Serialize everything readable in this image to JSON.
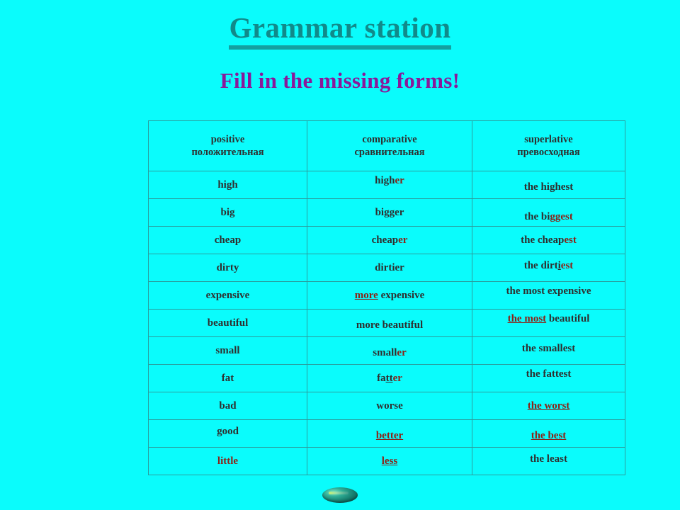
{
  "title": "Grammar station",
  "subtitle": "Fill in the missing forms!",
  "colors": {
    "background": "#0afcfc",
    "title": "#118a8a",
    "title_underline": "#13a0a0",
    "subtitle": "#8a189a",
    "table_border": "#2b9c9c",
    "text_dark": "#2f2f2f",
    "text_highlight": "#8a2318"
  },
  "table": {
    "headers": [
      {
        "en": "positive",
        "ru": "положительная"
      },
      {
        "en": "comparative",
        "ru": "сравнительная"
      },
      {
        "en": "superlative",
        "ru": "превосходная"
      }
    ],
    "rows": [
      {
        "positive": {
          "parts": [
            {
              "text": "high",
              "style": "dark"
            }
          ]
        },
        "comparative": {
          "parts": [
            {
              "text": "high",
              "style": "dark"
            },
            {
              "text": "er",
              "style": "hl"
            }
          ]
        },
        "superlative": {
          "parts": [
            {
              "text": "the highest",
              "style": "dark"
            }
          ]
        }
      },
      {
        "positive": {
          "parts": [
            {
              "text": "big",
              "style": "dark"
            }
          ]
        },
        "comparative": {
          "parts": [
            {
              "text": "bigger",
              "style": "dark"
            }
          ]
        },
        "superlative": {
          "parts": [
            {
              "text": "the bi",
              "style": "dark"
            },
            {
              "text": "gg",
              "style": "hl-u"
            },
            {
              "text": "est",
              "style": "hl"
            }
          ]
        }
      },
      {
        "positive": {
          "parts": [
            {
              "text": "cheap",
              "style": "dark"
            }
          ]
        },
        "comparative": {
          "parts": [
            {
              "text": "cheap",
              "style": "dark"
            },
            {
              "text": "er",
              "style": "hl"
            }
          ]
        },
        "superlative": {
          "parts": [
            {
              "text": "the cheap",
              "style": "dark"
            },
            {
              "text": "est",
              "style": "hl"
            }
          ]
        }
      },
      {
        "positive": {
          "parts": [
            {
              "text": "dirty",
              "style": "dark"
            }
          ]
        },
        "comparative": {
          "parts": [
            {
              "text": "dirtier",
              "style": "dark"
            }
          ]
        },
        "superlative": {
          "parts": [
            {
              "text": "the dirt",
              "style": "dark"
            },
            {
              "text": "i",
              "style": "dark-u"
            },
            {
              "text": "est",
              "style": "hl"
            }
          ]
        }
      },
      {
        "positive": {
          "parts": [
            {
              "text": "expensive",
              "style": "dark"
            }
          ]
        },
        "comparative": {
          "parts": [
            {
              "text": "more",
              "style": "hl-u"
            },
            {
              "text": " expensive",
              "style": "dark"
            }
          ]
        },
        "superlative": {
          "parts": [
            {
              "text": "the most expensive",
              "style": "dark"
            }
          ]
        }
      },
      {
        "positive": {
          "parts": [
            {
              "text": "beautiful",
              "style": "dark"
            }
          ]
        },
        "comparative": {
          "parts": [
            {
              "text": "more beautiful",
              "style": "dark"
            }
          ]
        },
        "superlative": {
          "parts": [
            {
              "text": "the most",
              "style": "hl-u"
            },
            {
              "text": " beautiful",
              "style": "dark"
            }
          ]
        }
      },
      {
        "positive": {
          "parts": [
            {
              "text": "small",
              "style": "dark"
            }
          ]
        },
        "comparative": {
          "parts": [
            {
              "text": "small",
              "style": "dark"
            },
            {
              "text": "er",
              "style": "hl"
            }
          ]
        },
        "superlative": {
          "parts": [
            {
              "text": "the smallest",
              "style": "dark"
            }
          ]
        }
      },
      {
        "positive": {
          "parts": [
            {
              "text": "fat",
              "style": "dark"
            }
          ]
        },
        "comparative": {
          "parts": [
            {
              "text": "fa",
              "style": "dark"
            },
            {
              "text": "tt",
              "style": "dark-u"
            },
            {
              "text": "er",
              "style": "hl"
            }
          ]
        },
        "superlative": {
          "parts": [
            {
              "text": "the fattest",
              "style": "dark"
            }
          ]
        }
      },
      {
        "positive": {
          "parts": [
            {
              "text": "bad",
              "style": "dark"
            }
          ]
        },
        "comparative": {
          "parts": [
            {
              "text": "worse",
              "style": "dark"
            }
          ]
        },
        "superlative": {
          "parts": [
            {
              "text": "the worst",
              "style": "hl-u"
            }
          ]
        }
      },
      {
        "positive": {
          "parts": [
            {
              "text": "good",
              "style": "dark"
            }
          ]
        },
        "comparative": {
          "parts": [
            {
              "text": "better",
              "style": "hl-u"
            }
          ]
        },
        "superlative": {
          "parts": [
            {
              "text": "the best",
              "style": "hl-u"
            }
          ]
        }
      },
      {
        "positive": {
          "parts": [
            {
              "text": "little",
              "style": "hl"
            }
          ]
        },
        "comparative": {
          "parts": [
            {
              "text": "less",
              "style": "hl-u"
            }
          ]
        },
        "superlative": {
          "parts": [
            {
              "text": "the least",
              "style": "dark"
            }
          ]
        }
      }
    ],
    "cell_nudges": [
      [
        "",
        "nudge-up",
        "nudge-down2"
      ],
      [
        "",
        "",
        "nudge-down"
      ],
      [
        "",
        "",
        ""
      ],
      [
        "",
        "",
        "nudge-up2"
      ],
      [
        "",
        "",
        "nudge-up"
      ],
      [
        "",
        "nudge-down2",
        "nudge-up"
      ],
      [
        "",
        "nudge-down2",
        "nudge-up2"
      ],
      [
        "",
        "",
        "nudge-up"
      ],
      [
        "",
        "",
        ""
      ],
      [
        "nudge-up2",
        "nudge-down2",
        "nudge-down2"
      ],
      [
        "",
        "",
        "nudge-up2"
      ]
    ]
  },
  "nav_button": {
    "icon": "next-slide-button"
  }
}
